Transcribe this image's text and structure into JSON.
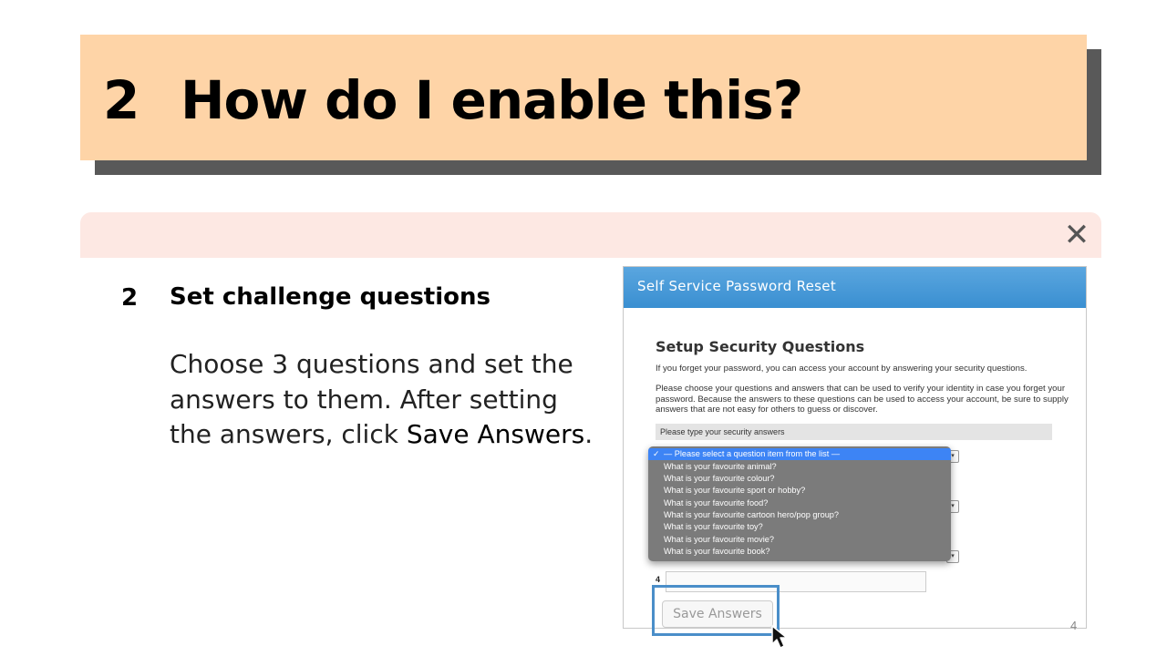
{
  "slide": {
    "number": "2",
    "title": "How do I enable this?",
    "page_number": "4"
  },
  "step": {
    "number": "2",
    "title": "Set challenge questions",
    "body_part1": "Choose 3 questions and set the answers to them. After setting the answers, click ",
    "body_emph": "Save Answers",
    "body_part2": "."
  },
  "close_icon": "close-icon",
  "screenshot": {
    "header": "Self Service Password Reset",
    "heading": "Setup Security Questions",
    "intro": "If you forget your password, you can access your account by answering your security questions.",
    "instructions": "Please choose your questions and answers that can be used to verify your identity in case you forget your password. Because the answers to these questions can be used to access your account, be sure to supply answers that are not easy for others to guess or discover.",
    "band_label": "Please type your security answers",
    "question4_label": "4",
    "save_button": "Save Answers",
    "dropdown": {
      "selected": "— Please select a question item from the list —",
      "options": [
        "What is your favourite animal?",
        "What is your favourite colour?",
        "What is your favourite sport or hobby?",
        "What is your favourite food?",
        "What is your favourite cartoon hero/pop group?",
        "What is your favourite toy?",
        "What is your favourite movie?",
        "What is your favourite book?"
      ]
    }
  },
  "colors": {
    "banner": "#fed4a7",
    "banner_shadow": "#595959",
    "strip": "#fde8e3",
    "header_blue": "#3a8fd1",
    "highlight": "#4a8ec9",
    "dropdown_selected": "#3d84f5"
  }
}
